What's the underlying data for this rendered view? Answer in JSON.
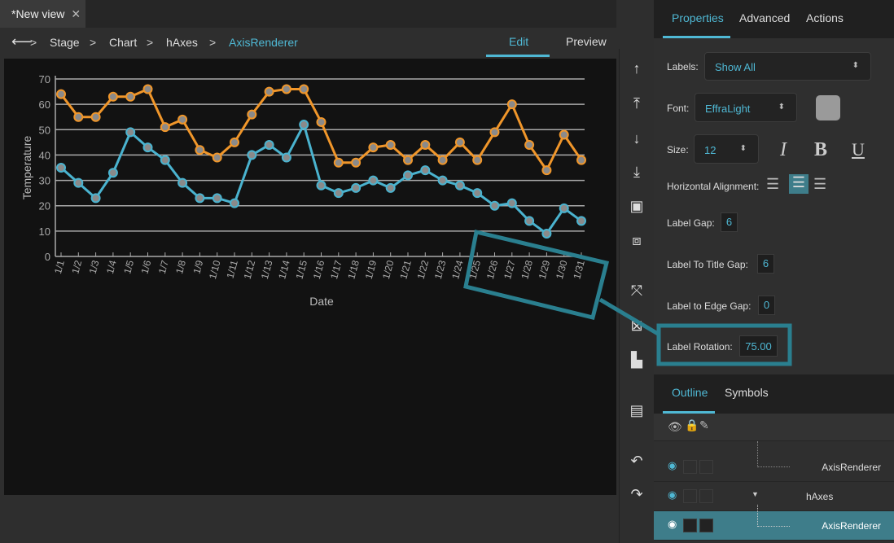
{
  "document_tab": {
    "title": "*New view",
    "close": "✕"
  },
  "breadcrumb": {
    "back": "⟵",
    "items": [
      "Stage",
      "Chart",
      "hAxes",
      "AxisRenderer"
    ],
    "separator": ">"
  },
  "modes": {
    "edit": "Edit",
    "preview": "Preview",
    "active": "Edit"
  },
  "toolbar": {
    "icons": [
      "move-up-icon",
      "move-to-top-icon",
      "move-down-icon",
      "move-to-bottom-icon",
      "fit-frame-icon",
      "crop-icon",
      "expand-icon",
      "fit-content-icon",
      "align-left-icon",
      "page-icon",
      "undo-icon",
      "redo-icon"
    ]
  },
  "properties_panel": {
    "tabs": [
      "Properties",
      "Advanced",
      "Actions"
    ],
    "active_tab": "Properties",
    "labels_label": "Labels:",
    "labels_value": "Show All",
    "font_label": "Font:",
    "font_value": "EffraLight",
    "font_color": "#9a9a9a",
    "size_label": "Size:",
    "size_value": "12",
    "italic": "I",
    "bold": "B",
    "underline": "U",
    "halign_label": "Horizontal Alignment:",
    "halign_value": "center",
    "label_gap_label": "Label Gap:",
    "label_gap_value": "6",
    "label_to_title_gap_label": "Label To Title Gap:",
    "label_to_title_gap_value": "6",
    "label_to_edge_gap_label": "Label to Edge Gap:",
    "label_to_edge_gap_value": "0",
    "label_rotation_label": "Label Rotation:",
    "label_rotation_value": "75.00"
  },
  "outline_panel": {
    "tabs": [
      "Outline",
      "Symbols"
    ],
    "active_tab": "Outline",
    "rows": [
      {
        "name": "AxisRenderer",
        "selected": false
      },
      {
        "name": "hAxes",
        "selected": false
      },
      {
        "name": "AxisRenderer",
        "selected": true
      }
    ]
  },
  "colors": {
    "accent": "#4fb8d4",
    "series_orange": "#f0962a",
    "series_blue": "#4ab3cf",
    "callout": "#2a7f8f",
    "selected_row": "#3e7d8a"
  },
  "chart_data": {
    "type": "line",
    "xlabel": "Date",
    "ylabel": "Temperature",
    "ylim": [
      0,
      70
    ],
    "yticks": [
      "0",
      "10",
      "20",
      "30",
      "40",
      "50",
      "60",
      "70"
    ],
    "grid": "horizontal",
    "categories": [
      "1/1",
      "1/2",
      "1/3",
      "1/4",
      "1/5",
      "1/6",
      "1/7",
      "1/8",
      "1/9",
      "1/10",
      "1/11",
      "1/12",
      "1/13",
      "1/14",
      "1/15",
      "1/16",
      "1/17",
      "1/18",
      "1/19",
      "1/20",
      "1/21",
      "1/22",
      "1/23",
      "1/24",
      "1/25",
      "1/26",
      "1/27",
      "1/28",
      "1/29",
      "1/30",
      "1/31"
    ],
    "series": [
      {
        "color": "#f0962a",
        "values": [
          64,
          55,
          55,
          63,
          63,
          66,
          51,
          54,
          42,
          39,
          45,
          56,
          65,
          66,
          66,
          53,
          37,
          37,
          43,
          44,
          38,
          44,
          38,
          45,
          38,
          49,
          60,
          44,
          34,
          48,
          38
        ]
      },
      {
        "color": "#4ab3cf",
        "values": [
          35,
          29,
          23,
          33,
          49,
          43,
          38,
          29,
          23,
          23,
          21,
          40,
          44,
          39,
          52,
          28,
          25,
          27,
          30,
          27,
          32,
          34,
          30,
          28,
          25,
          20,
          21,
          14,
          9,
          19,
          14
        ]
      }
    ]
  }
}
